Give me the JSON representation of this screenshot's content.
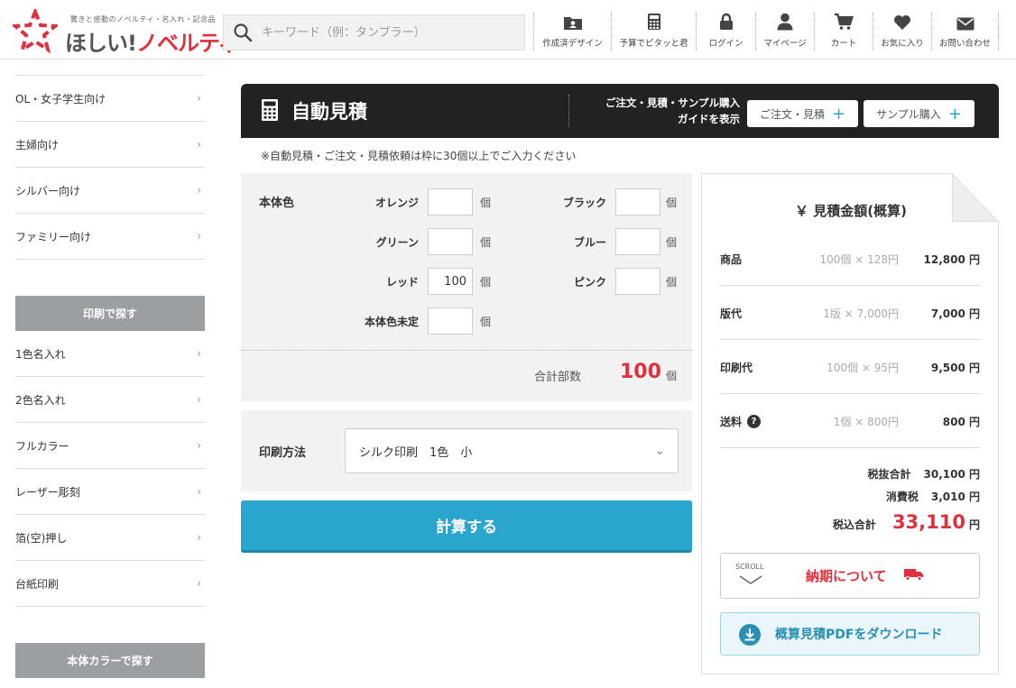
{
  "header": {
    "logo_tagline": "驚きと感動のノベルティ・名入れ・記念品",
    "logo_text_a": "ほしい!",
    "logo_text_b": "ノベルティ",
    "search_placeholder": "キーワード（例：タンブラー）",
    "nav": [
      {
        "label": "作成済デザイン",
        "icon": "folder-user-icon"
      },
      {
        "label": "予算でピタッと君",
        "icon": "calculator-icon"
      },
      {
        "label": "ログイン",
        "icon": "lock-icon"
      },
      {
        "label": "マイページ",
        "icon": "user-icon"
      },
      {
        "label": "カート",
        "icon": "cart-icon"
      },
      {
        "label": "お気に入り",
        "icon": "heart-icon"
      },
      {
        "label": "お問い合わせ",
        "icon": "mail-icon"
      }
    ]
  },
  "sidebar": {
    "target_items": [
      "OL・女子学生向け",
      "主婦向け",
      "シルバー向け",
      "ファミリー向け"
    ],
    "print_heading": "印刷で探す",
    "print_items": [
      "1色名入れ",
      "2色名入れ",
      "フルカラー",
      "レーザー彫刻",
      "箔(空)押し",
      "台紙印刷"
    ],
    "color_heading": "本体カラーで探す"
  },
  "estimate_head": {
    "title": "自動見積",
    "guide_line1": "ご注文・見積・サンプル購入",
    "guide_line2": "ガイドを表示",
    "order_button": "ご注文・見積",
    "sample_button": "サンプル購入"
  },
  "notice": "※自動見積・ご注文・見積依頼は枠に30個以上でご入力ください",
  "colors": {
    "section_label": "本体色",
    "unit": "個",
    "items": [
      {
        "name": "オレンジ",
        "value": ""
      },
      {
        "name": "ブラック",
        "value": ""
      },
      {
        "name": "グリーン",
        "value": ""
      },
      {
        "name": "ブルー",
        "value": ""
      },
      {
        "name": "レッド",
        "value": "100"
      },
      {
        "name": "ピンク",
        "value": ""
      },
      {
        "name": "本体色未定",
        "value": ""
      }
    ],
    "total_label": "合計部数",
    "total_value": "100",
    "total_unit": "個"
  },
  "print": {
    "label": "印刷方法",
    "selected": "シルク印刷　1色　小"
  },
  "calc_button": "計算する",
  "quote": {
    "title": "￥ 見積金額(概算)",
    "rows": [
      {
        "label": "商品",
        "calc": "100個 × 128円",
        "amount": "12,800 円"
      },
      {
        "label": "版代",
        "calc": "1版 × 7,000円",
        "amount": "7,000 円"
      },
      {
        "label": "印刷代",
        "calc": "100個 × 95円",
        "amount": "9,500 円"
      },
      {
        "label": "送料",
        "calc": "1個 × 800円",
        "amount": "800 円"
      }
    ],
    "subtotal_label": "税抜合計",
    "subtotal_value": "30,100 円",
    "tax_label": "消費税",
    "tax_value": "3,010 円",
    "grand_label": "税込合計",
    "grand_value": "33,110",
    "grand_unit": "円",
    "scroll_label": "SCROLL",
    "delivery_label": "納期について",
    "pdf_label": "概算見積PDFをダウンロード",
    "accent_red": "#e0303e",
    "accent_blue": "#2aa5cd"
  }
}
